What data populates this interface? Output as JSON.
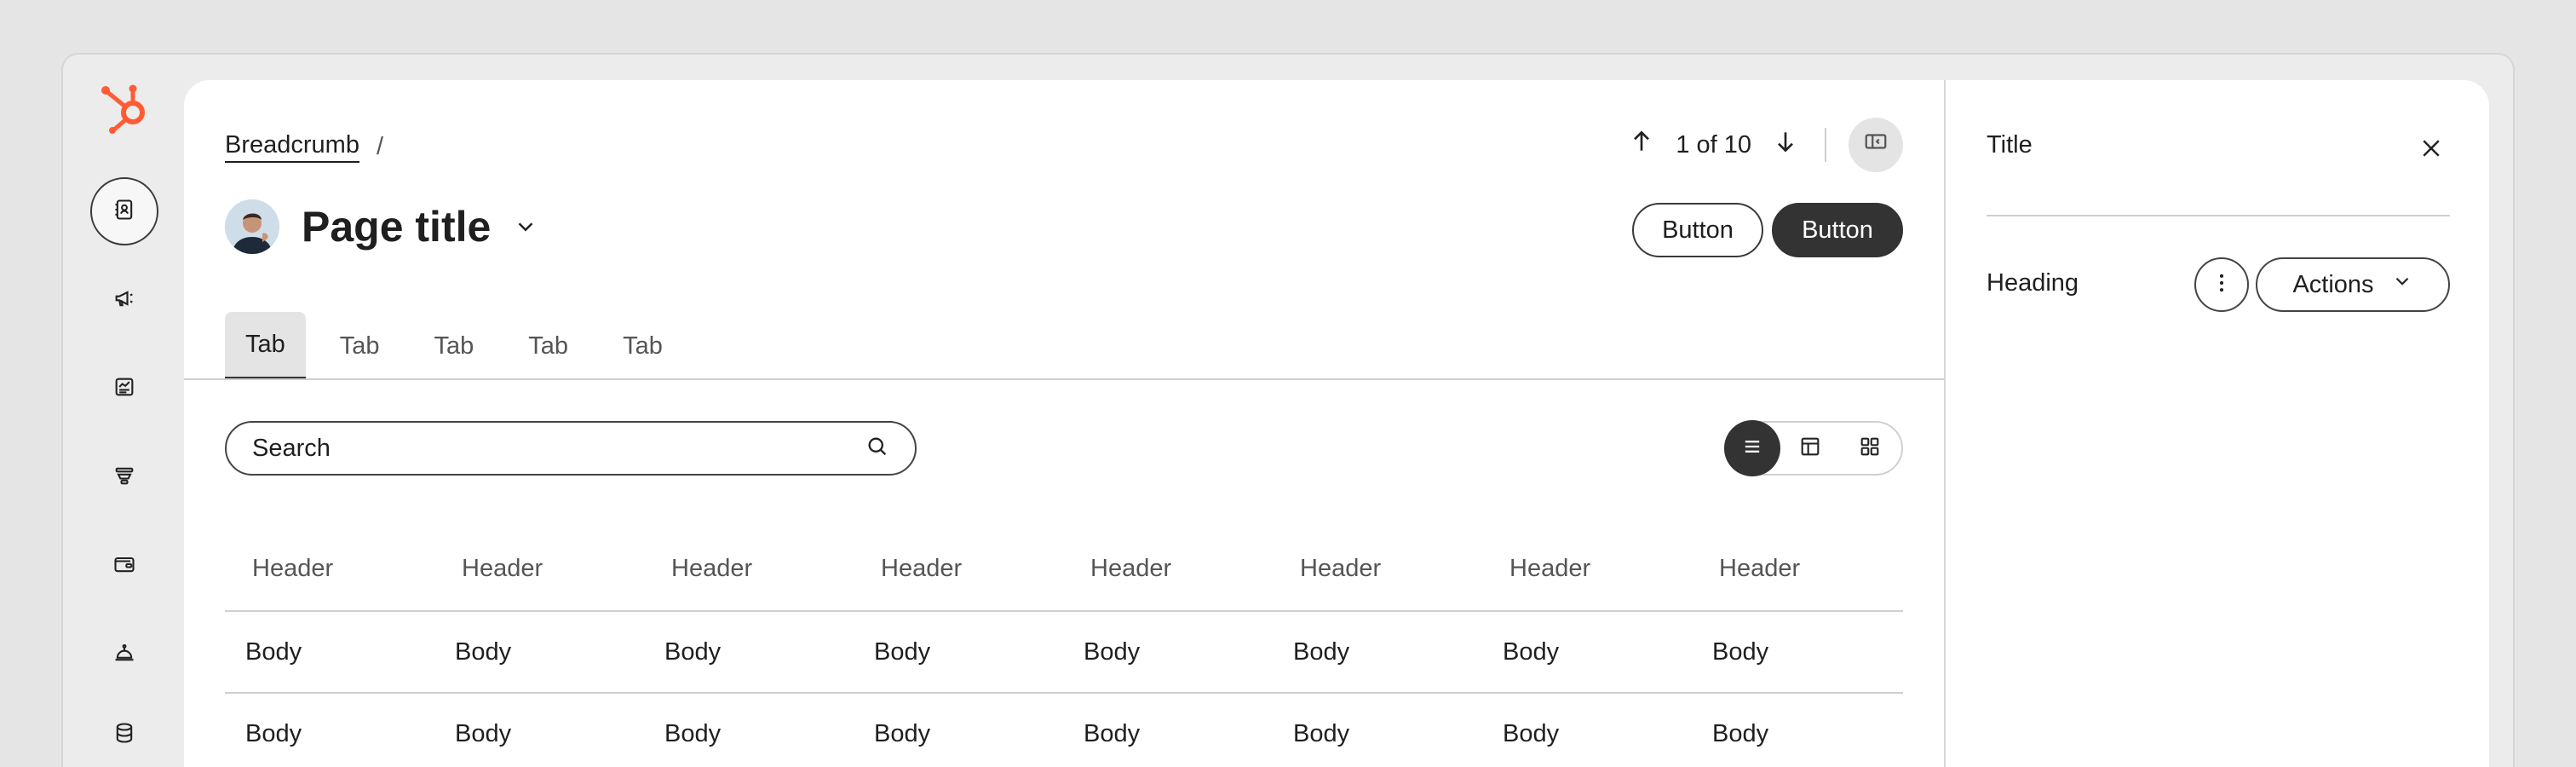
{
  "nav": {
    "logo": "hubspot-logo",
    "items": [
      {
        "icon": "contacts-icon",
        "active": true
      },
      {
        "icon": "megaphone-icon",
        "active": false
      },
      {
        "icon": "report-icon",
        "active": false
      },
      {
        "icon": "funnel-icon",
        "active": false
      },
      {
        "icon": "wallet-icon",
        "active": false
      },
      {
        "icon": "service-bell-icon",
        "active": false
      },
      {
        "icon": "database-icon",
        "active": false
      }
    ]
  },
  "header": {
    "breadcrumb": "Breadcrumb",
    "breadcrumb_sep": "/",
    "title": "Page title",
    "pager": "1 of 10",
    "secondary_button": "Button",
    "primary_button": "Button"
  },
  "tabs": [
    "Tab",
    "Tab",
    "Tab",
    "Tab",
    "Tab"
  ],
  "search": {
    "placeholder": "Search"
  },
  "table": {
    "headers": [
      "Header",
      "Header",
      "Header",
      "Header",
      "Header",
      "Header",
      "Header",
      "Header"
    ],
    "rows": [
      [
        "Body",
        "Body",
        "Body",
        "Body",
        "Body",
        "Body",
        "Body",
        "Body"
      ],
      [
        "Body",
        "Body",
        "Body",
        "Body",
        "Body",
        "Body",
        "Body",
        "Body"
      ]
    ]
  },
  "side_panel": {
    "title": "Title",
    "heading": "Heading",
    "actions_label": "Actions"
  },
  "colors": {
    "brand": "#ff5c35",
    "primary_button": "#333333",
    "background": "#e5e5e5"
  }
}
